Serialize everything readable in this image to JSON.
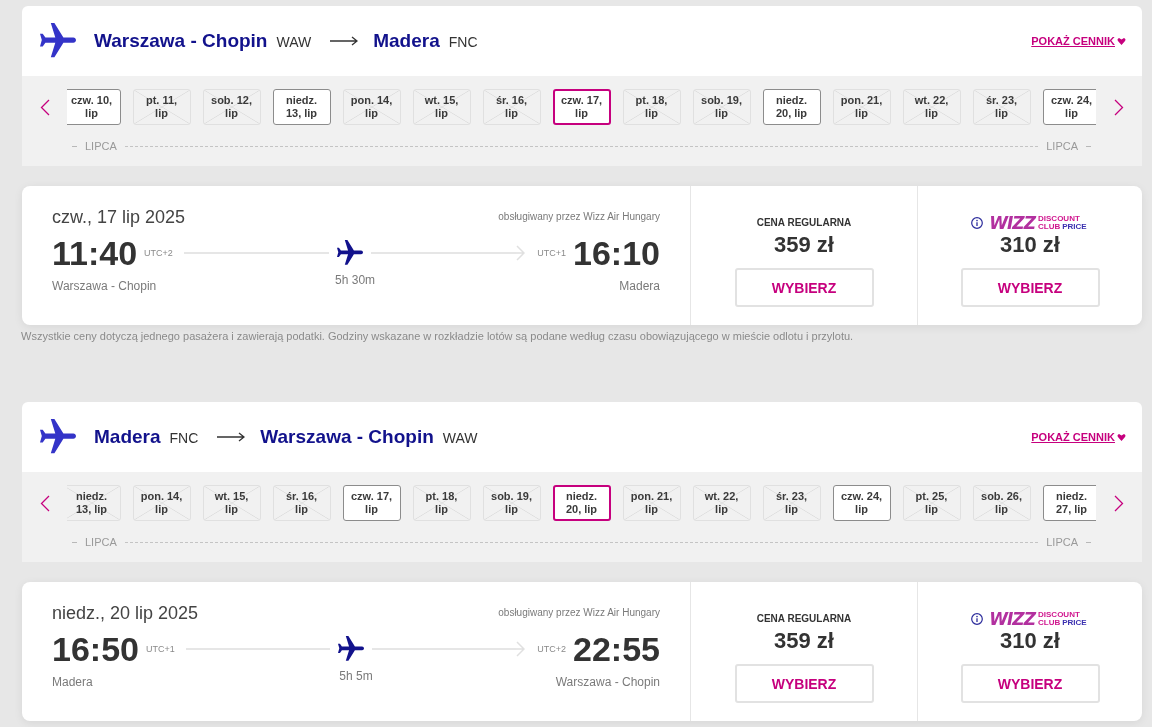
{
  "flights": [
    {
      "origin": {
        "name": "Warszawa - Chopin",
        "code": "WAW"
      },
      "destination": {
        "name": "Madera",
        "code": "FNC"
      },
      "price_list_link": "POKAŻ CENNIK",
      "dates": [
        {
          "label": "czw. 10, lip",
          "available": true,
          "selected": false
        },
        {
          "label": "pt. 11, lip",
          "available": false,
          "selected": false
        },
        {
          "label": "sob. 12, lip",
          "available": false,
          "selected": false
        },
        {
          "label": "niedz. 13, lip",
          "available": true,
          "selected": false
        },
        {
          "label": "pon. 14, lip",
          "available": false,
          "selected": false
        },
        {
          "label": "wt. 15, lip",
          "available": false,
          "selected": false
        },
        {
          "label": "śr. 16, lip",
          "available": false,
          "selected": false
        },
        {
          "label": "czw. 17, lip",
          "available": true,
          "selected": true
        },
        {
          "label": "pt. 18, lip",
          "available": false,
          "selected": false
        },
        {
          "label": "sob. 19, lip",
          "available": false,
          "selected": false
        },
        {
          "label": "niedz. 20, lip",
          "available": true,
          "selected": false
        },
        {
          "label": "pon. 21, lip",
          "available": false,
          "selected": false
        },
        {
          "label": "wt. 22, lip",
          "available": false,
          "selected": false
        },
        {
          "label": "śr. 23, lip",
          "available": false,
          "selected": false
        },
        {
          "label": "czw. 24, lip",
          "available": true,
          "selected": false
        }
      ],
      "months": [
        "LIPCA",
        "LIPCA"
      ],
      "card": {
        "date": "czw., 17 lip 2025",
        "operator": "obsługiwany przez Wizz Air Hungary",
        "departure": {
          "time": "11:40",
          "utc": "UTC+2",
          "city": "Warszawa - Chopin"
        },
        "duration": "5h 30m",
        "arrival": {
          "time": "16:10",
          "utc": "UTC+1",
          "city": "Madera"
        },
        "fares": [
          {
            "kind": "regular",
            "label": "CENA REGULARNA",
            "price": "359 zł",
            "button": "WYBIERZ"
          },
          {
            "kind": "club",
            "logo": {
              "wordmark": "WIZZ",
              "line_1": "DISCOUNT",
              "line_2": [
                "CLUB",
                "PRICE"
              ]
            },
            "price": "310 zł",
            "button": "WYBIERZ"
          }
        ]
      },
      "footnote": "Wszystkie ceny dotyczą jednego pasażera i zawierają podatki. Godziny wskazane w rozkładzie lotów są podane według czasu obowiązującego w mieście odlotu i przylotu."
    },
    {
      "origin": {
        "name": "Madera",
        "code": "FNC"
      },
      "destination": {
        "name": "Warszawa - Chopin",
        "code": "WAW"
      },
      "price_list_link": "POKAŻ CENNIK",
      "dates": [
        {
          "label": "niedz. 13, lip",
          "available": false,
          "selected": false
        },
        {
          "label": "pon. 14, lip",
          "available": false,
          "selected": false
        },
        {
          "label": "wt. 15, lip",
          "available": false,
          "selected": false
        },
        {
          "label": "śr. 16, lip",
          "available": false,
          "selected": false
        },
        {
          "label": "czw. 17, lip",
          "available": true,
          "selected": false
        },
        {
          "label": "pt. 18, lip",
          "available": false,
          "selected": false
        },
        {
          "label": "sob. 19, lip",
          "available": false,
          "selected": false
        },
        {
          "label": "niedz. 20, lip",
          "available": true,
          "selected": true
        },
        {
          "label": "pon. 21, lip",
          "available": false,
          "selected": false
        },
        {
          "label": "wt. 22, lip",
          "available": false,
          "selected": false
        },
        {
          "label": "śr. 23, lip",
          "available": false,
          "selected": false
        },
        {
          "label": "czw. 24, lip",
          "available": true,
          "selected": false
        },
        {
          "label": "pt. 25, lip",
          "available": false,
          "selected": false
        },
        {
          "label": "sob. 26, lip",
          "available": false,
          "selected": false
        },
        {
          "label": "niedz. 27, lip",
          "available": true,
          "selected": false
        }
      ],
      "months": [
        "LIPCA",
        "LIPCA"
      ],
      "card": {
        "date": "niedz., 20 lip 2025",
        "operator": "obsługiwany przez Wizz Air Hungary",
        "departure": {
          "time": "16:50",
          "utc": "UTC+1",
          "city": "Madera"
        },
        "duration": "5h 5m",
        "arrival": {
          "time": "22:55",
          "utc": "UTC+2",
          "city": "Warszawa - Chopin"
        },
        "fares": [
          {
            "kind": "regular",
            "label": "CENA REGULARNA",
            "price": "359 zł",
            "button": "WYBIERZ"
          },
          {
            "kind": "club",
            "logo": {
              "wordmark": "WIZZ",
              "line_1": "DISCOUNT",
              "line_2": [
                "CLUB",
                "PRICE"
              ]
            },
            "price": "310 zł",
            "button": "WYBIERZ"
          }
        ]
      }
    }
  ]
}
